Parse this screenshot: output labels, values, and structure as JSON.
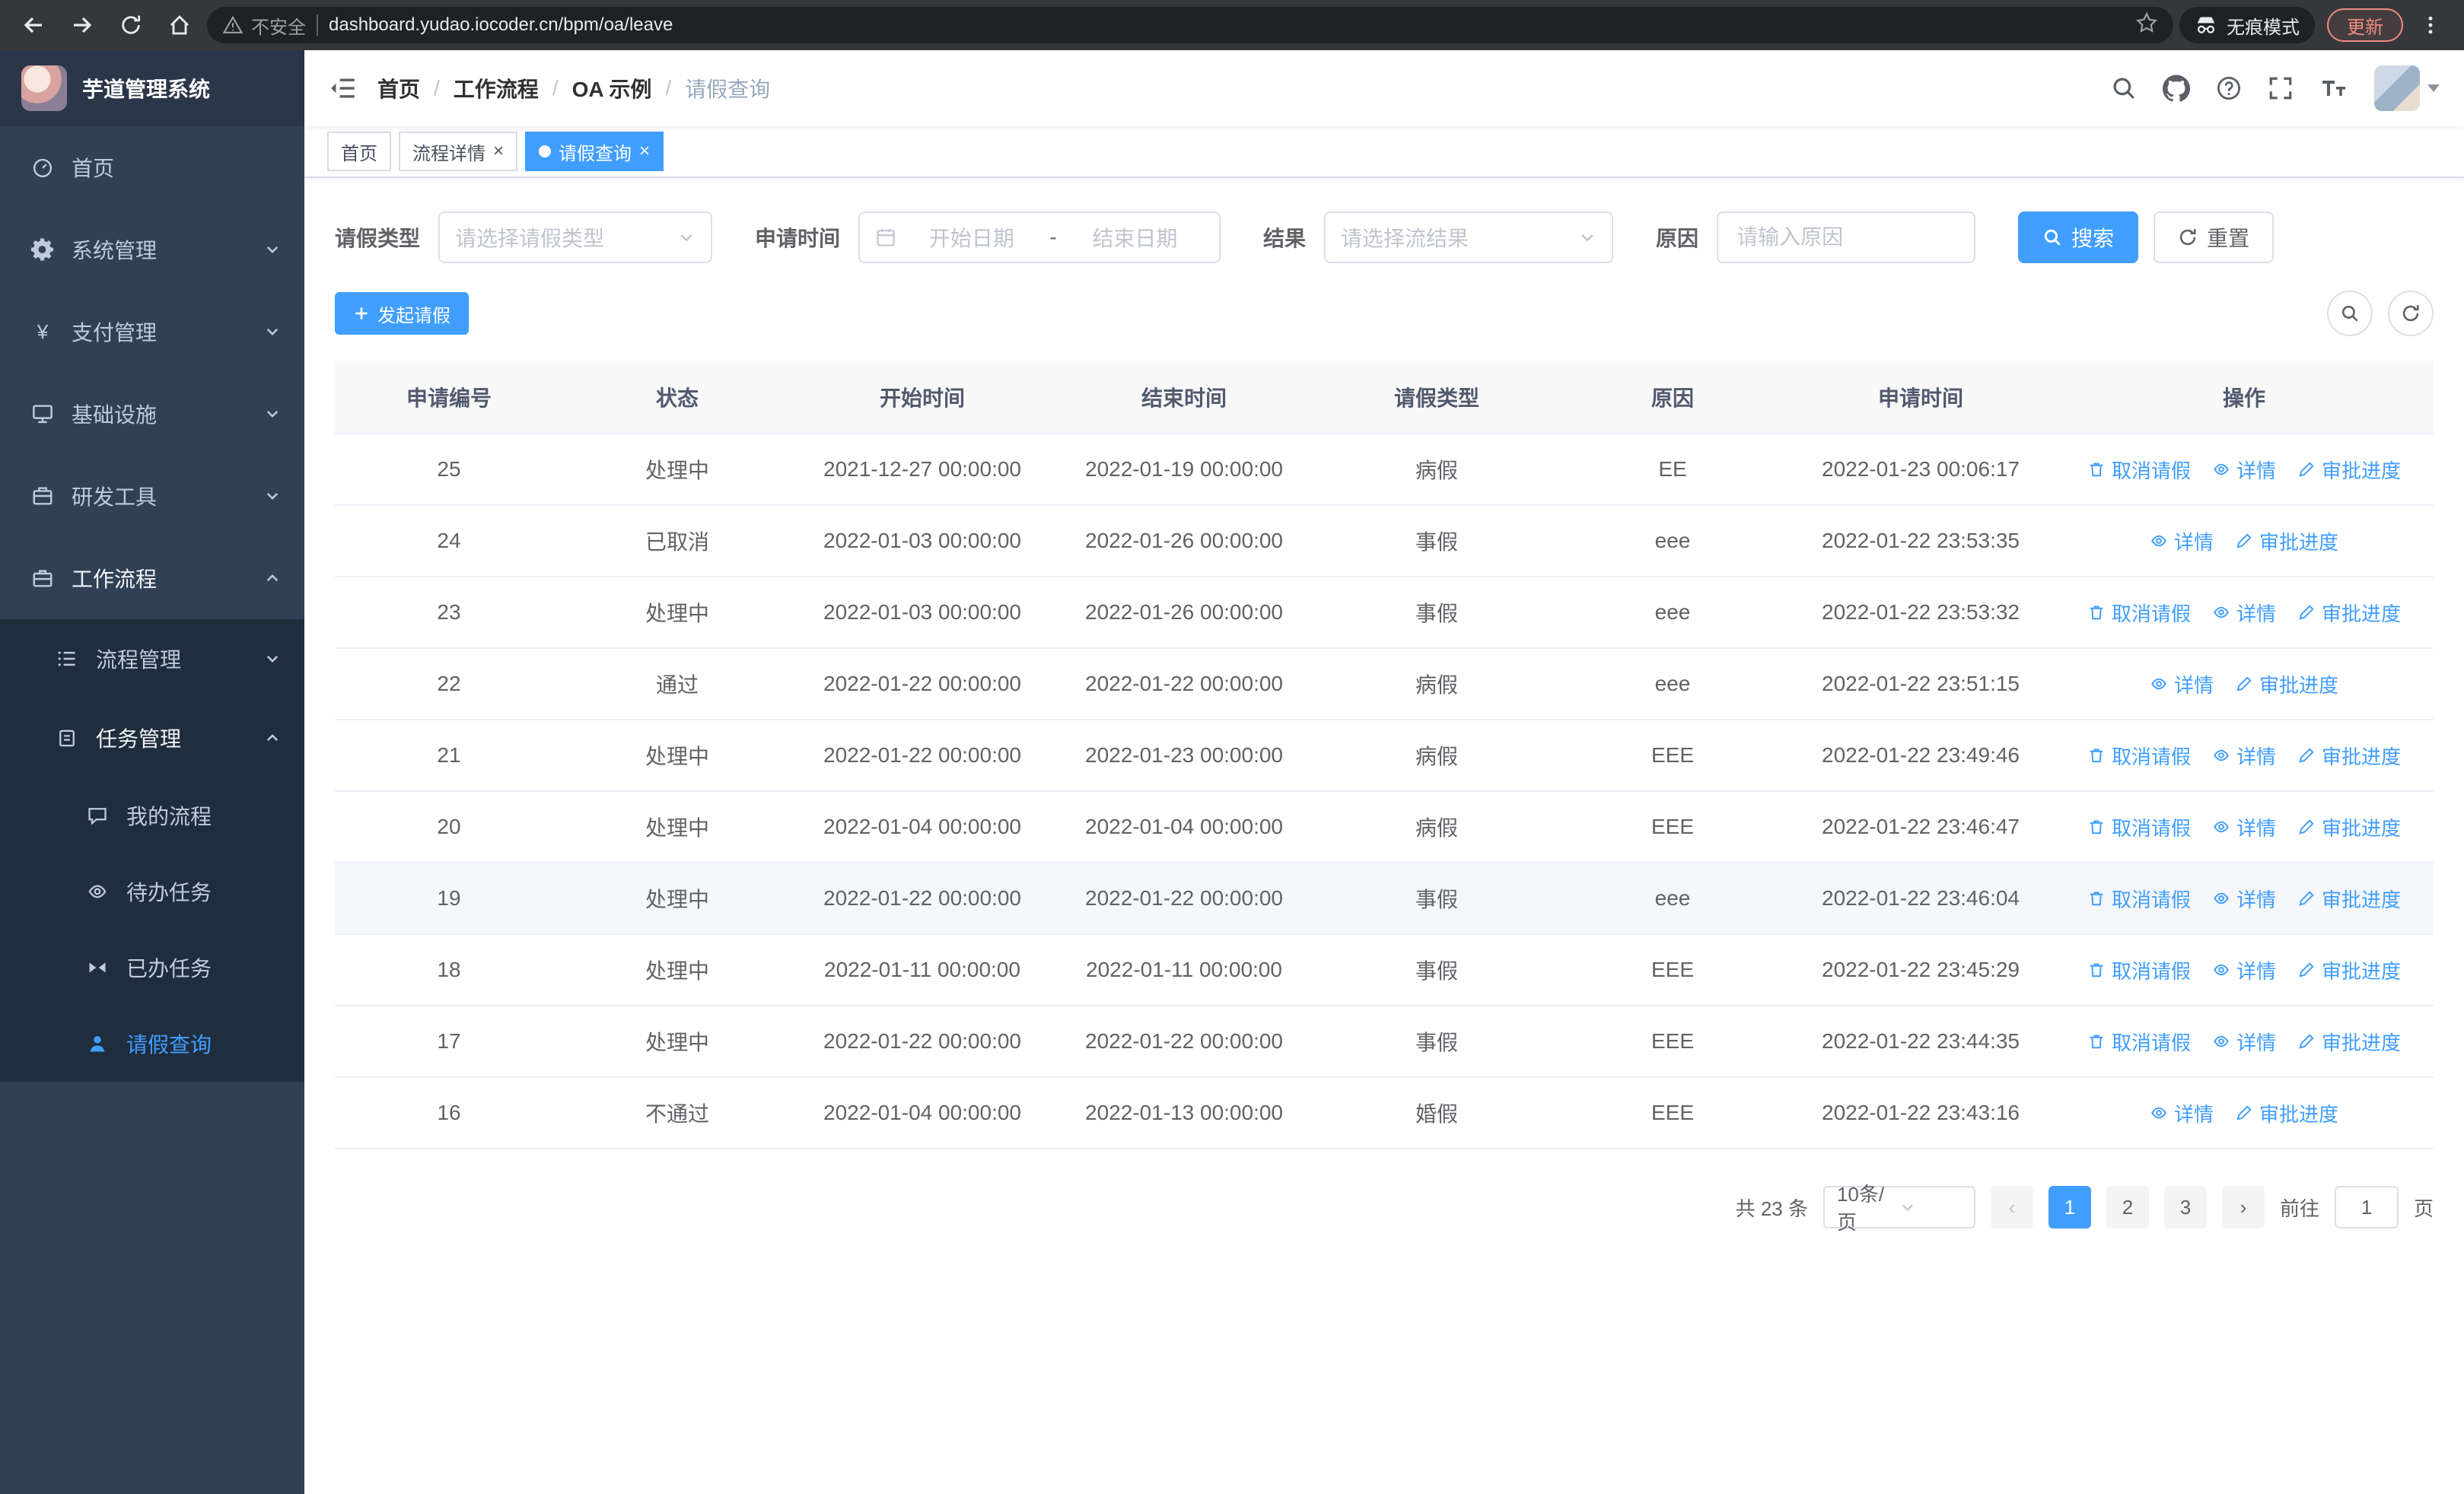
{
  "browser": {
    "security_label": "不安全",
    "url": "dashboard.yudao.iocoder.cn/bpm/oa/leave",
    "incognito_label": "无痕模式",
    "update_label": "更新"
  },
  "app": {
    "title": "芋道管理系统"
  },
  "sidebar": {
    "items": [
      {
        "label": "首页",
        "icon": "dashboard-icon"
      },
      {
        "label": "系统管理",
        "icon": "gear-icon"
      },
      {
        "label": "支付管理",
        "icon": "yen-icon"
      },
      {
        "label": "基础设施",
        "icon": "monitor-icon"
      },
      {
        "label": "研发工具",
        "icon": "toolbox-icon"
      },
      {
        "label": "工作流程",
        "icon": "briefcase-icon",
        "expanded": true
      }
    ],
    "workflow_children": [
      {
        "label": "流程管理",
        "icon": "list-icon"
      },
      {
        "label": "任务管理",
        "icon": "clipboard-icon",
        "expanded": true
      }
    ],
    "task_children": [
      {
        "label": "我的流程",
        "icon": "chat-icon"
      },
      {
        "label": "待办任务",
        "icon": "eye-icon"
      },
      {
        "label": "已办任务",
        "icon": "bowtie-icon"
      },
      {
        "label": "请假查询",
        "icon": "user-icon",
        "active": true
      }
    ]
  },
  "icons": {
    "yen": "¥",
    "close": "×"
  },
  "breadcrumb": {
    "separator": "/",
    "items": [
      "首页",
      "工作流程",
      "OA 示例",
      "请假查询"
    ]
  },
  "tabs": [
    {
      "label": "首页",
      "active": false,
      "closable": false
    },
    {
      "label": "流程详情",
      "active": false,
      "closable": true
    },
    {
      "label": "请假查询",
      "active": true,
      "closable": true
    }
  ],
  "filters": {
    "type_label": "请假类型",
    "type_placeholder": "请选择请假类型",
    "time_label": "申请时间",
    "start_placeholder": "开始日期",
    "range_separator": "-",
    "end_placeholder": "结束日期",
    "result_label": "结果",
    "result_placeholder": "请选择流结果",
    "reason_label": "原因",
    "reason_placeholder": "请输入原因",
    "search_button": "搜索",
    "reset_button": "重置"
  },
  "toolbar": {
    "create_button": "发起请假"
  },
  "table": {
    "headers": [
      "申请编号",
      "状态",
      "开始时间",
      "结束时间",
      "请假类型",
      "原因",
      "申请时间",
      "操作"
    ],
    "action_labels": {
      "cancel": "取消请假",
      "detail": "详情",
      "progress": "审批进度"
    },
    "rows": [
      {
        "id": "25",
        "status": "处理中",
        "start_time": "2021-12-27 00:00:00",
        "end_time": "2022-01-19 00:00:00",
        "type": "病假",
        "reason": "EE",
        "apply_time": "2022-01-23 00:06:17",
        "can_cancel": true,
        "highlighted": false
      },
      {
        "id": "24",
        "status": "已取消",
        "start_time": "2022-01-03 00:00:00",
        "end_time": "2022-01-26 00:00:00",
        "type": "事假",
        "reason": "eee",
        "apply_time": "2022-01-22 23:53:35",
        "can_cancel": false,
        "highlighted": false
      },
      {
        "id": "23",
        "status": "处理中",
        "start_time": "2022-01-03 00:00:00",
        "end_time": "2022-01-26 00:00:00",
        "type": "事假",
        "reason": "eee",
        "apply_time": "2022-01-22 23:53:32",
        "can_cancel": true,
        "highlighted": false
      },
      {
        "id": "22",
        "status": "通过",
        "start_time": "2022-01-22 00:00:00",
        "end_time": "2022-01-22 00:00:00",
        "type": "病假",
        "reason": "eee",
        "apply_time": "2022-01-22 23:51:15",
        "can_cancel": false,
        "highlighted": false
      },
      {
        "id": "21",
        "status": "处理中",
        "start_time": "2022-01-22 00:00:00",
        "end_time": "2022-01-23 00:00:00",
        "type": "病假",
        "reason": "EEE",
        "apply_time": "2022-01-22 23:49:46",
        "can_cancel": true,
        "highlighted": false
      },
      {
        "id": "20",
        "status": "处理中",
        "start_time": "2022-01-04 00:00:00",
        "end_time": "2022-01-04 00:00:00",
        "type": "病假",
        "reason": "EEE",
        "apply_time": "2022-01-22 23:46:47",
        "can_cancel": true,
        "highlighted": false
      },
      {
        "id": "19",
        "status": "处理中",
        "start_time": "2022-01-22 00:00:00",
        "end_time": "2022-01-22 00:00:00",
        "type": "事假",
        "reason": "eee",
        "apply_time": "2022-01-22 23:46:04",
        "can_cancel": true,
        "highlighted": true
      },
      {
        "id": "18",
        "status": "处理中",
        "start_time": "2022-01-11 00:00:00",
        "end_time": "2022-01-11 00:00:00",
        "type": "事假",
        "reason": "EEE",
        "apply_time": "2022-01-22 23:45:29",
        "can_cancel": true,
        "highlighted": false
      },
      {
        "id": "17",
        "status": "处理中",
        "start_time": "2022-01-22 00:00:00",
        "end_time": "2022-01-22 00:00:00",
        "type": "事假",
        "reason": "EEE",
        "apply_time": "2022-01-22 23:44:35",
        "can_cancel": true,
        "highlighted": false
      },
      {
        "id": "16",
        "status": "不通过",
        "start_time": "2022-01-04 00:00:00",
        "end_time": "2022-01-13 00:00:00",
        "type": "婚假",
        "reason": "EEE",
        "apply_time": "2022-01-22 23:43:16",
        "can_cancel": false,
        "highlighted": false
      }
    ]
  },
  "pagination": {
    "total": "共 23 条",
    "page_size": "10条/页",
    "prev": "‹",
    "next": "›",
    "pages": [
      {
        "label": "1",
        "active": true
      },
      {
        "label": "2",
        "active": false
      },
      {
        "label": "3",
        "active": false
      }
    ],
    "goto_label": "前往",
    "goto_value": "1",
    "goto_suffix": "页"
  },
  "colors": {
    "primary": "#409eff",
    "sidebar_bg": "#304156",
    "submenu_bg": "#1f2d3d",
    "header_bg": "#f8f8f9"
  }
}
